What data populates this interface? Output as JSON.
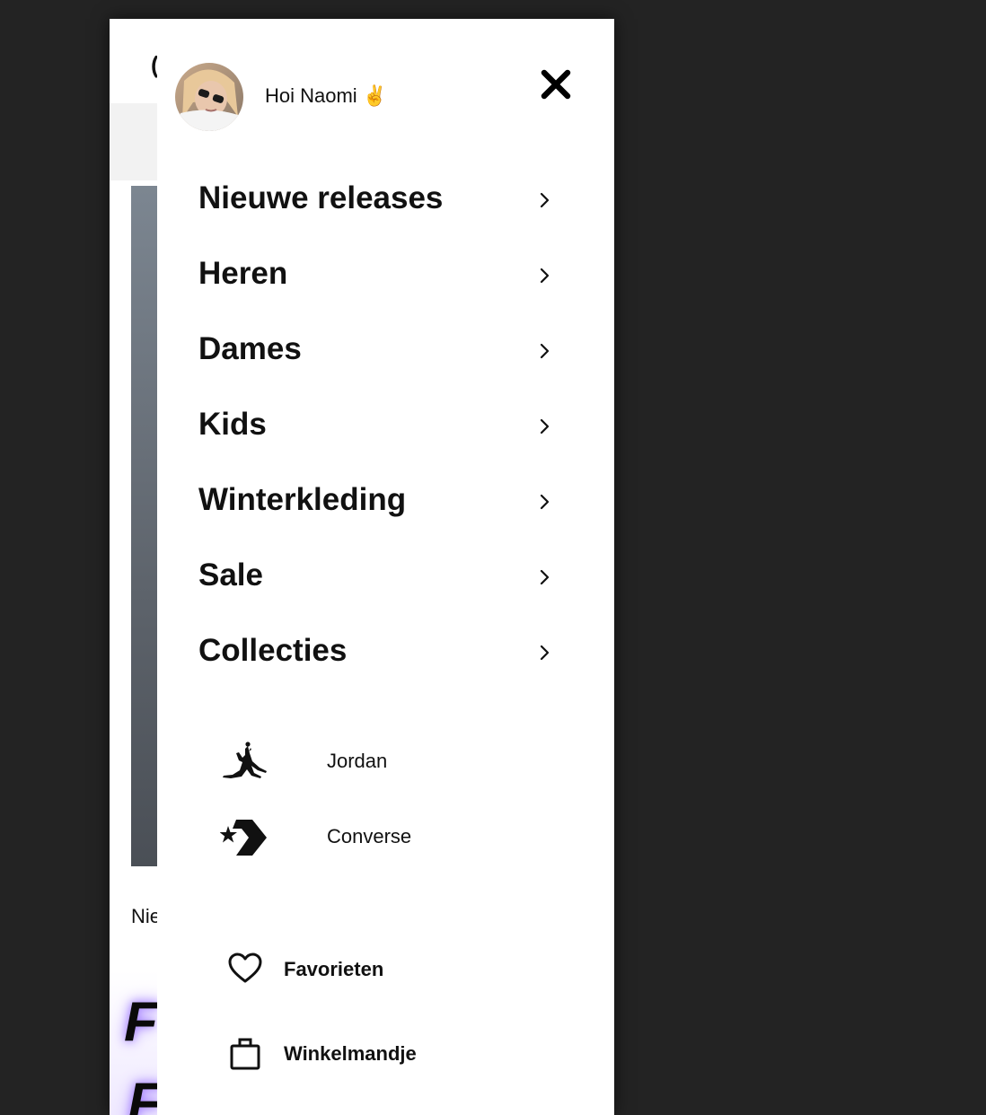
{
  "greeting": {
    "text": "Hoi Naomi",
    "emoji": "✌️"
  },
  "header": {
    "close_icon": "close-icon",
    "avatar_icon": "user-avatar"
  },
  "nav": {
    "items": [
      {
        "label": "Nieuwe releases"
      },
      {
        "label": "Heren"
      },
      {
        "label": "Dames"
      },
      {
        "label": "Kids"
      },
      {
        "label": "Winterkleding"
      },
      {
        "label": "Sale"
      },
      {
        "label": "Collecties"
      }
    ],
    "chevron_icon": "chevron-right-icon"
  },
  "brands": {
    "items": [
      {
        "label": "Jordan",
        "icon": "jordan-jumpman-icon"
      },
      {
        "label": "Converse",
        "icon": "converse-star-chevron-icon"
      }
    ]
  },
  "account": {
    "items": [
      {
        "label": "Favorieten",
        "icon": "heart-icon"
      },
      {
        "label": "Winkelmandje",
        "icon": "shopping-bag-icon"
      }
    ]
  },
  "underlay": {
    "partial_text": "Nie",
    "partial_logo": "(",
    "promo_text_1": "F",
    "promo_text_2": "F"
  },
  "colors": {
    "backdrop": "#232323",
    "drawer_bg": "#ffffff",
    "text": "#111111",
    "promo_glow": "#a07bff"
  }
}
